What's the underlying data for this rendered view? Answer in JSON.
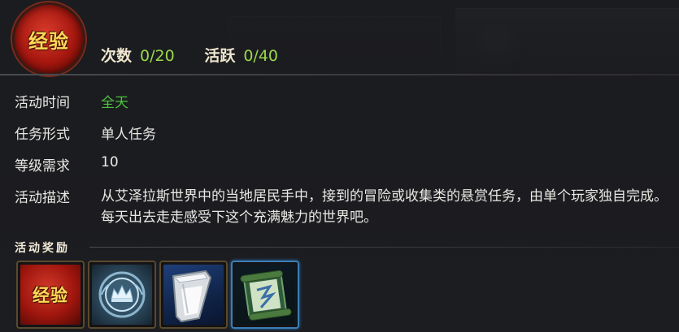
{
  "badge": {
    "label": "经验"
  },
  "stats": {
    "count_label": "次数",
    "count_value": "0/20",
    "activity_label": "活跃",
    "activity_value": "0/40"
  },
  "background": {
    "window_title": ""
  },
  "details": {
    "time_label": "活动时间",
    "time_value": "全天",
    "form_label": "任务形式",
    "form_value": "单人任务",
    "level_label": "等级需求",
    "level_value": "10",
    "desc_label": "活动描述",
    "desc_value": "从艾泽拉斯世界中的当地居民手中，接到的冒险或收集类的悬赏任务，由单个玩家独自完成。每天出去走走感受下这个充满魅力的世界吧。"
  },
  "rewards": {
    "title": "活动奖励",
    "items": [
      {
        "name": "exp",
        "label": "经验",
        "icon": "exp-icon"
      },
      {
        "name": "reputation",
        "icon": "crown-emblem-icon"
      },
      {
        "name": "milk",
        "icon": "milk-cup-icon"
      },
      {
        "name": "scroll",
        "icon": "scroll-icon",
        "selected": true
      }
    ]
  },
  "colors": {
    "accent_green": "#49c43a",
    "stat_green": "#9bd84b",
    "exp_red": "#a6170f",
    "exp_gold": "#ffd85a",
    "selected_border": "#3a7fb8"
  }
}
